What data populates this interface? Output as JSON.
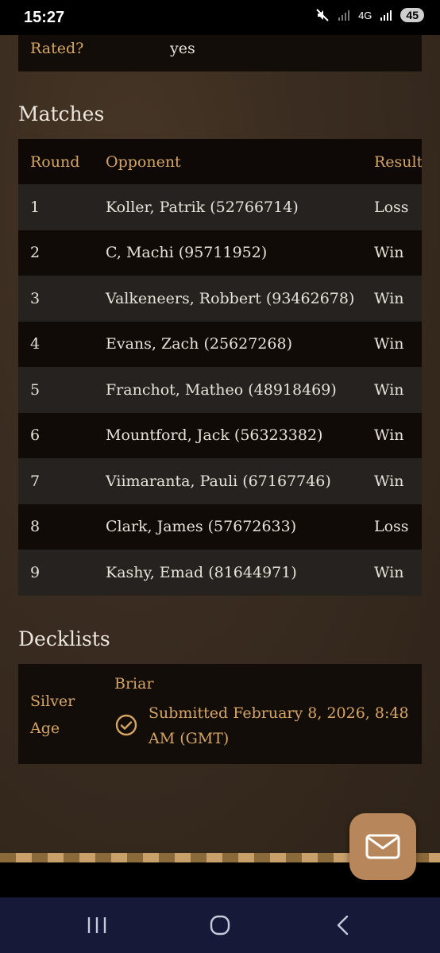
{
  "status_bar": {
    "time": "15:27",
    "network": "4G",
    "battery": "45"
  },
  "details": {
    "rated_label": "Rated?",
    "rated_value": "yes"
  },
  "matches": {
    "title": "Matches",
    "columns": [
      "Round",
      "Opponent",
      "Result"
    ],
    "rows": [
      {
        "round": "1",
        "opponent": "Koller, Patrik (52766714)",
        "result": "Loss"
      },
      {
        "round": "2",
        "opponent": "C, Machi (95711952)",
        "result": "Win"
      },
      {
        "round": "3",
        "opponent": "Valkeneers, Robbert (93462678)",
        "result": "Win"
      },
      {
        "round": "4",
        "opponent": "Evans, Zach (25627268)",
        "result": "Win"
      },
      {
        "round": "5",
        "opponent": "Franchot, Matheo (48918469)",
        "result": "Win"
      },
      {
        "round": "6",
        "opponent": "Mountford, Jack (56323382)",
        "result": "Win"
      },
      {
        "round": "7",
        "opponent": "Viimaranta, Pauli (67167746)",
        "result": "Win"
      },
      {
        "round": "8",
        "opponent": "Clark, James (57672633)",
        "result": "Loss"
      },
      {
        "round": "9",
        "opponent": "Kashy, Emad (81644971)",
        "result": "Win"
      }
    ]
  },
  "decklists": {
    "title": "Decklists",
    "format": "Silver Age",
    "deck_name": "Briar",
    "submitted": "Submitted February 8, 2026, 8:48 AM (GMT)",
    "status_icon": "check-circle-icon"
  },
  "fab": {
    "icon": "mail-icon"
  },
  "colors": {
    "accent": "#d6a562",
    "background": "#3a2c20",
    "card": "#130d09",
    "fab": "#b7865a",
    "nav_bar": "#161a38"
  }
}
